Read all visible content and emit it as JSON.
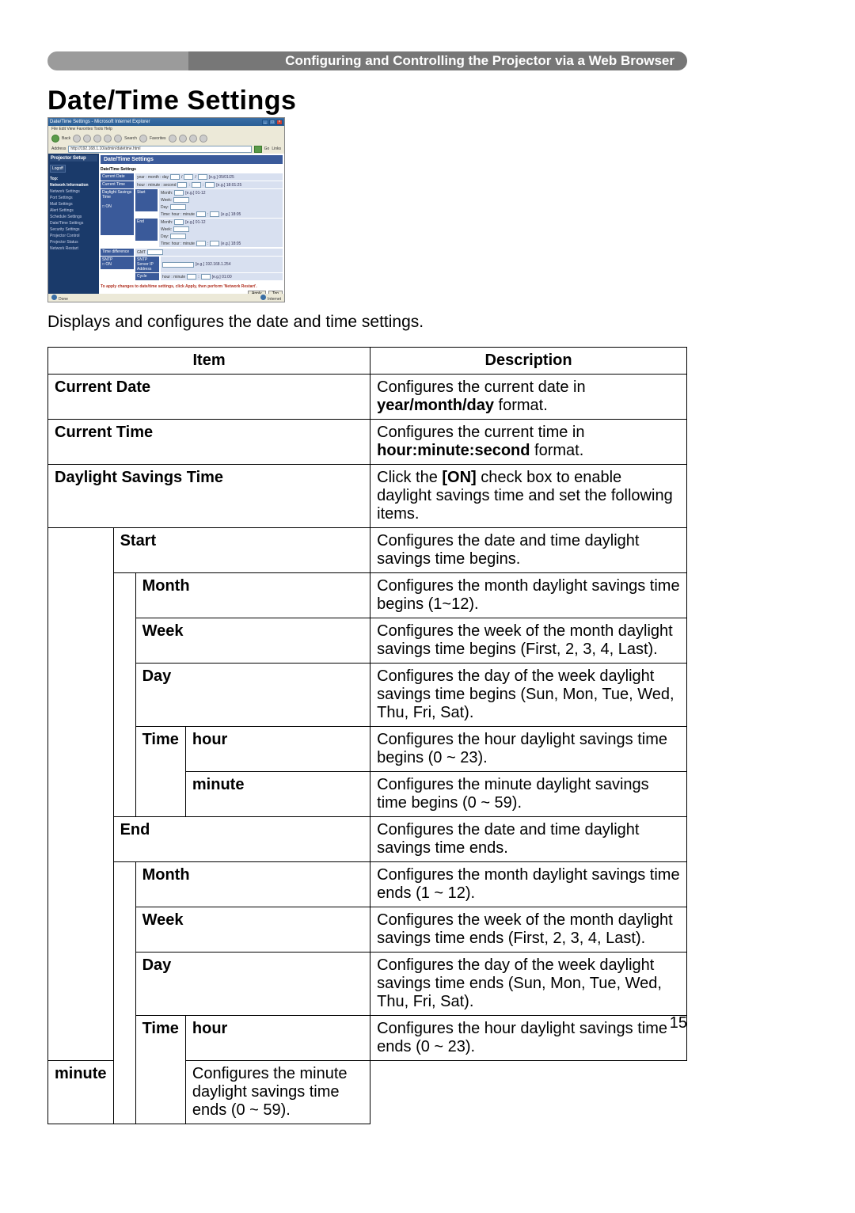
{
  "header": {
    "title": "Configuring and Controlling the Projector via a Web Browser"
  },
  "main_title": "Date/Time Settings",
  "intro": "Displays and configures the date and time settings.",
  "page_number": "15",
  "screenshot": {
    "window_title": "Date/Time Settings - Microsoft Internet Explorer",
    "menu": "File   Edit   View   Favorites   Tools   Help",
    "toolbar_back": "Back",
    "toolbar_search": "Search",
    "toolbar_fav": "Favorites",
    "addr_label": "Address",
    "addr_value": "http://192.168.1.10/admin/datetime.html",
    "go": "Go",
    "links": "Links",
    "side_head": "Projector Setup",
    "logoff": "Logoff",
    "nav": [
      "Top:",
      "Network Information",
      "Network Settings",
      "Port Settings",
      "Mail Settings",
      "Alert Settings",
      "Schedule Settings",
      "Date/Time Settings",
      "Security Settings",
      "Projector Control",
      "Projector Status",
      "Network Restart"
    ],
    "main_head": "Date/Time Settings",
    "section": "Date/Time Settings",
    "lbl_current_date": "Current Date",
    "val_current_date": "year : month : day",
    "eg_current_date": "[e.g.] 05/01/25",
    "lbl_current_time": "Current Time",
    "val_current_time": "hour : minute : second",
    "eg_current_time": "[e.g.] 18:01:25",
    "lbl_dst": "Daylight Savings Time",
    "chk_on": "ON",
    "lbl_start": "Start",
    "lbl_end": "End",
    "lbl_month": "Month:",
    "eg_month": "[e.g.] 01-12",
    "lbl_week": "Week:",
    "lbl_day": "Day:",
    "lbl_time": "Time: hour : minute",
    "eg_time": "[e.g.] 18:05",
    "lbl_timediff": "Time difference",
    "lbl_gmt": "GMT",
    "lbl_sntp": "SNTP",
    "lbl_sntp_ip": "SNTP Server IP Address",
    "eg_ip": "[e.g.] 192.168.1.254",
    "lbl_cycle": "Cycle",
    "val_cycle": "hour : minute",
    "eg_cycle": "[e.g.] 01:00",
    "note": "To apply changes to date/time settings, click Apply, then perform 'Network Restart'.",
    "btn_apply": "Apply",
    "btn_top": "Top",
    "status_done": "Done",
    "status_zone": "Internet"
  },
  "table": {
    "head_item": "Item",
    "head_desc": "Description",
    "rows": {
      "current_date": {
        "item": "Current Date",
        "desc_pre": "Configures the current date in ",
        "desc_bold": "year/month/day",
        "desc_post": " format."
      },
      "current_time": {
        "item": "Current Time",
        "desc_pre": "Configures the current time in ",
        "desc_bold": "hour:minute:second",
        "desc_post": " format."
      },
      "dst": {
        "item": "Daylight Savings Time",
        "desc_pre": "Click the ",
        "desc_bold": "[ON]",
        "desc_post": " check box to enable daylight savings time and set the following items."
      },
      "start": {
        "item": "Start",
        "desc": "Configures the date and time daylight savings time begins."
      },
      "start_month": {
        "item": "Month",
        "desc": "Configures the month daylight savings time begins (1~12)."
      },
      "start_week": {
        "item": "Week",
        "desc": "Configures the week of the month daylight savings time begins (First, 2, 3, 4, Last)."
      },
      "start_day": {
        "item": "Day",
        "desc": "Configures the day of the week daylight savings time begins (Sun, Mon, Tue, Wed, Thu, Fri, Sat)."
      },
      "start_time": {
        "item": "Time",
        "hour": "hour",
        "minute": "minute",
        "desc_hour": "Configures the hour daylight savings time begins (0 ~ 23).",
        "desc_min": "Configures the minute daylight savings time begins (0 ~ 59)."
      },
      "end": {
        "item": "End",
        "desc": "Configures the date and time daylight savings time ends."
      },
      "end_month": {
        "item": "Month",
        "desc": "Configures the month daylight savings time ends (1 ~ 12)."
      },
      "end_week": {
        "item": "Week",
        "desc": "Configures the week of the month daylight savings time ends (First, 2, 3, 4, Last)."
      },
      "end_day": {
        "item": "Day",
        "desc": "Configures the day of the week daylight savings time ends (Sun, Mon, Tue, Wed, Thu, Fri, Sat)."
      },
      "end_time": {
        "item": "Time",
        "hour": "hour",
        "minute": "minute",
        "desc_hour": "Configures the hour daylight savings time ends (0 ~ 23).",
        "desc_min": "Configures the minute daylight savings time ends  (0 ~ 59)."
      }
    }
  }
}
